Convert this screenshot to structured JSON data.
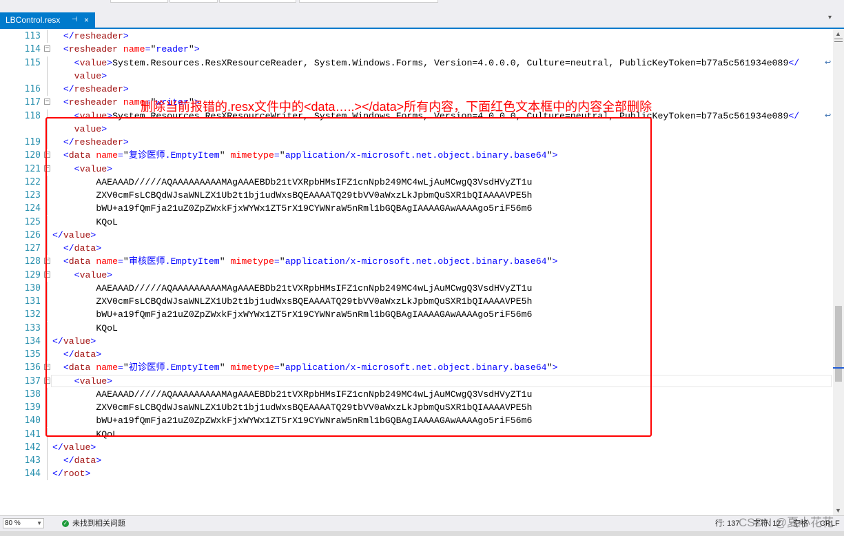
{
  "tab": {
    "title": "LBControl.resx",
    "pin": "⊣",
    "close": "×"
  },
  "annotation": "删除当前报错的.resx文件中的<data…..></data>所有内容，下面红色文本框中的内容全部删除",
  "lines": [
    {
      "n": "113",
      "fold": "",
      "indent": "  ",
      "parts": [
        [
          "br",
          "</"
        ],
        [
          "tag",
          "resheader"
        ],
        [
          "br",
          ">"
        ]
      ]
    },
    {
      "n": "114",
      "fold": "−",
      "indent": "  ",
      "parts": [
        [
          "br",
          "<"
        ],
        [
          "tag",
          "resheader"
        ],
        [
          "txt",
          " "
        ],
        [
          "attr",
          "name"
        ],
        [
          "br",
          "="
        ],
        [
          "txt",
          "\""
        ],
        [
          "val",
          "reader"
        ],
        [
          "txt",
          "\""
        ],
        [
          "br",
          ">"
        ]
      ]
    },
    {
      "n": "115",
      "fold": "",
      "indent": "    ",
      "wrap": true,
      "parts": [
        [
          "br",
          "<"
        ],
        [
          "tag",
          "value"
        ],
        [
          "br",
          ">"
        ],
        [
          "txt",
          "System.Resources.ResXResourceReader, System.Windows.Forms, Version=4.0.0.0, Culture=neutral, PublicKeyToken=b77a5c561934e089"
        ],
        [
          "br",
          "</"
        ]
      ]
    },
    {
      "n": "",
      "fold": "",
      "indent": "    ",
      "parts": [
        [
          "tag",
          "value"
        ],
        [
          "br",
          ">"
        ]
      ]
    },
    {
      "n": "116",
      "fold": "",
      "indent": "  ",
      "parts": [
        [
          "br",
          "</"
        ],
        [
          "tag",
          "resheader"
        ],
        [
          "br",
          ">"
        ]
      ]
    },
    {
      "n": "117",
      "fold": "−",
      "indent": "  ",
      "parts": [
        [
          "br",
          "<"
        ],
        [
          "tag",
          "resheader"
        ],
        [
          "txt",
          " "
        ],
        [
          "attr",
          "name"
        ],
        [
          "br",
          "="
        ],
        [
          "txt",
          "\""
        ],
        [
          "val",
          "writer"
        ],
        [
          "txt",
          "\""
        ],
        [
          "br",
          ">"
        ]
      ]
    },
    {
      "n": "118",
      "fold": "",
      "indent": "    ",
      "wrap": true,
      "parts": [
        [
          "br",
          "<"
        ],
        [
          "tag",
          "value"
        ],
        [
          "br",
          ">"
        ],
        [
          "txt",
          "System.Resources.ResXResourceWriter, System.Windows.Forms, Version=4.0.0.0, Culture=neutral, PublicKeyToken=b77a5c561934e089"
        ],
        [
          "br",
          "</"
        ]
      ]
    },
    {
      "n": "",
      "fold": "",
      "indent": "    ",
      "parts": [
        [
          "tag",
          "value"
        ],
        [
          "br",
          ">"
        ]
      ]
    },
    {
      "n": "119",
      "fold": "",
      "indent": "  ",
      "parts": [
        [
          "br",
          "</"
        ],
        [
          "tag",
          "resheader"
        ],
        [
          "br",
          ">"
        ]
      ]
    },
    {
      "n": "120",
      "fold": "−",
      "indent": "  ",
      "parts": [
        [
          "br",
          "<"
        ],
        [
          "tag",
          "data"
        ],
        [
          "txt",
          " "
        ],
        [
          "attr",
          "name"
        ],
        [
          "br",
          "="
        ],
        [
          "txt",
          "\""
        ],
        [
          "val",
          "复诊医师.EmptyItem"
        ],
        [
          "txt",
          "\" "
        ],
        [
          "attr",
          "mimetype"
        ],
        [
          "br",
          "="
        ],
        [
          "txt",
          "\""
        ],
        [
          "val",
          "application/x-microsoft.net.object.binary.base64"
        ],
        [
          "txt",
          "\""
        ],
        [
          "br",
          ">"
        ]
      ]
    },
    {
      "n": "121",
      "fold": "−",
      "indent": "    ",
      "parts": [
        [
          "br",
          "<"
        ],
        [
          "tag",
          "value"
        ],
        [
          "br",
          ">"
        ]
      ]
    },
    {
      "n": "122",
      "fold": "",
      "indent": "        ",
      "parts": [
        [
          "txt",
          "AAEAAAD/////AQAAAAAAAAAMAgAAAEBDb21tVXRpbHMsIFZ1cnNpb249MC4wLjAuMCwgQ3VsdHVyZT1u"
        ]
      ]
    },
    {
      "n": "123",
      "fold": "",
      "indent": "        ",
      "parts": [
        [
          "txt",
          "ZXV0cmFsLCBQdWJsaWNLZX1Ub2t1bj1udWxsBQEAAAATQ29tbVV0aWxzLkJpbmQuSXR1bQIAAAAVPE5h"
        ]
      ]
    },
    {
      "n": "124",
      "fold": "",
      "indent": "        ",
      "parts": [
        [
          "txt",
          "bWU+a19fQmFja21uZ0ZpZWxkFjxWYWx1ZT5rX19CYWNraW5nRml1bGQBAgIAAAAGAwAAAAgo5riF56m6"
        ]
      ]
    },
    {
      "n": "125",
      "fold": "",
      "indent": "        ",
      "parts": [
        [
          "txt",
          "KQoL"
        ]
      ]
    },
    {
      "n": "126",
      "fold": "",
      "indent": "",
      "parts": [
        [
          "br",
          "</"
        ],
        [
          "tag",
          "value"
        ],
        [
          "br",
          ">"
        ]
      ]
    },
    {
      "n": "127",
      "fold": "",
      "indent": "  ",
      "parts": [
        [
          "br",
          "</"
        ],
        [
          "tag",
          "data"
        ],
        [
          "br",
          ">"
        ]
      ]
    },
    {
      "n": "128",
      "fold": "−",
      "indent": "  ",
      "parts": [
        [
          "br",
          "<"
        ],
        [
          "tag",
          "data"
        ],
        [
          "txt",
          " "
        ],
        [
          "attr",
          "name"
        ],
        [
          "br",
          "="
        ],
        [
          "txt",
          "\""
        ],
        [
          "val",
          "审核医师.EmptyItem"
        ],
        [
          "txt",
          "\" "
        ],
        [
          "attr",
          "mimetype"
        ],
        [
          "br",
          "="
        ],
        [
          "txt",
          "\""
        ],
        [
          "val",
          "application/x-microsoft.net.object.binary.base64"
        ],
        [
          "txt",
          "\""
        ],
        [
          "br",
          ">"
        ]
      ]
    },
    {
      "n": "129",
      "fold": "−",
      "indent": "    ",
      "parts": [
        [
          "br",
          "<"
        ],
        [
          "tag",
          "value"
        ],
        [
          "br",
          ">"
        ]
      ]
    },
    {
      "n": "130",
      "fold": "",
      "indent": "        ",
      "parts": [
        [
          "txt",
          "AAEAAAD/////AQAAAAAAAAAMAgAAAEBDb21tVXRpbHMsIFZ1cnNpb249MC4wLjAuMCwgQ3VsdHVyZT1u"
        ]
      ]
    },
    {
      "n": "131",
      "fold": "",
      "indent": "        ",
      "parts": [
        [
          "txt",
          "ZXV0cmFsLCBQdWJsaWNLZX1Ub2t1bj1udWxsBQEAAAATQ29tbVV0aWxzLkJpbmQuSXR1bQIAAAAVPE5h"
        ]
      ]
    },
    {
      "n": "132",
      "fold": "",
      "indent": "        ",
      "parts": [
        [
          "txt",
          "bWU+a19fQmFja21uZ0ZpZWxkFjxWYWx1ZT5rX19CYWNraW5nRml1bGQBAgIAAAAGAwAAAAgo5riF56m6"
        ]
      ]
    },
    {
      "n": "133",
      "fold": "",
      "indent": "        ",
      "parts": [
        [
          "txt",
          "KQoL"
        ]
      ]
    },
    {
      "n": "134",
      "fold": "",
      "indent": "",
      "parts": [
        [
          "br",
          "</"
        ],
        [
          "tag",
          "value"
        ],
        [
          "br",
          ">"
        ]
      ]
    },
    {
      "n": "135",
      "fold": "",
      "indent": "  ",
      "parts": [
        [
          "br",
          "</"
        ],
        [
          "tag",
          "data"
        ],
        [
          "br",
          ">"
        ]
      ]
    },
    {
      "n": "136",
      "fold": "−",
      "indent": "  ",
      "parts": [
        [
          "br",
          "<"
        ],
        [
          "tag",
          "data"
        ],
        [
          "txt",
          " "
        ],
        [
          "attr",
          "name"
        ],
        [
          "br",
          "="
        ],
        [
          "txt",
          "\""
        ],
        [
          "val",
          "初诊医师.EmptyItem"
        ],
        [
          "txt",
          "\" "
        ],
        [
          "attr",
          "mimetype"
        ],
        [
          "br",
          "="
        ],
        [
          "txt",
          "\""
        ],
        [
          "val",
          "application/x-microsoft.net.object.binary.base64"
        ],
        [
          "txt",
          "\""
        ],
        [
          "br",
          ">"
        ]
      ]
    },
    {
      "n": "137",
      "fold": "−",
      "indent": "    ",
      "current": true,
      "parts": [
        [
          "br",
          "<"
        ],
        [
          "tag",
          "value"
        ],
        [
          "br",
          ">"
        ]
      ]
    },
    {
      "n": "138",
      "fold": "",
      "indent": "        ",
      "parts": [
        [
          "txt",
          "AAEAAAD/////AQAAAAAAAAAMAgAAAEBDb21tVXRpbHMsIFZ1cnNpb249MC4wLjAuMCwgQ3VsdHVyZT1u"
        ]
      ]
    },
    {
      "n": "139",
      "fold": "",
      "indent": "        ",
      "parts": [
        [
          "txt",
          "ZXV0cmFsLCBQdWJsaWNLZX1Ub2t1bj1udWxsBQEAAAATQ29tbVV0aWxzLkJpbmQuSXR1bQIAAAAVPE5h"
        ]
      ]
    },
    {
      "n": "140",
      "fold": "",
      "indent": "        ",
      "parts": [
        [
          "txt",
          "bWU+a19fQmFja21uZ0ZpZWxkFjxWYWx1ZT5rX19CYWNraW5nRml1bGQBAgIAAAAGAwAAAAgo5riF56m6"
        ]
      ]
    },
    {
      "n": "141",
      "fold": "",
      "indent": "        ",
      "parts": [
        [
          "txt",
          "KQoL"
        ]
      ]
    },
    {
      "n": "142",
      "fold": "",
      "indent": "",
      "parts": [
        [
          "br",
          "</"
        ],
        [
          "tag",
          "value"
        ],
        [
          "br",
          ">"
        ]
      ]
    },
    {
      "n": "143",
      "fold": "",
      "indent": "  ",
      "parts": [
        [
          "br",
          "</"
        ],
        [
          "tag",
          "data"
        ],
        [
          "br",
          ">"
        ]
      ]
    },
    {
      "n": "144",
      "fold": "",
      "indent": "",
      "parts": [
        [
          "br",
          "</"
        ],
        [
          "tag",
          "root"
        ],
        [
          "br",
          ">"
        ]
      ]
    }
  ],
  "status": {
    "zoom": "80 %",
    "issues": "未找到相关问题",
    "line": "行: 137",
    "char": "字符: 12",
    "spaces": "空格",
    "eol": "CRLF"
  },
  "watermark": "CSDN @夏小花花",
  "colors": {
    "accent": "#007acc",
    "annotation": "#ff0000",
    "line_number": "#2b91af",
    "xml_tag": "#a31515",
    "xml_attr": "#ff0000",
    "xml_value": "#0000ff"
  }
}
